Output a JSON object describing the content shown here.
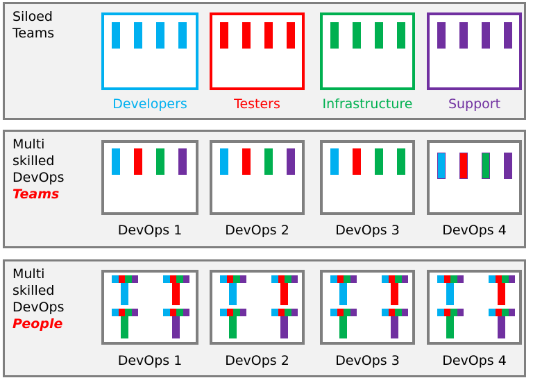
{
  "colors": {
    "developers": "#00b0f0",
    "testers": "#ff0000",
    "infrastructure": "#00b050",
    "support": "#7030a0",
    "frame": "#7f7f7f",
    "emphasis": "#ff0000"
  },
  "rows": [
    {
      "id": "siloed",
      "label_lines": [
        "Siloed",
        "Teams"
      ],
      "label_emphasis": "",
      "teams": [
        {
          "caption": "Developers",
          "frame": "developers",
          "members": [
            "developers",
            "developers",
            "developers",
            "developers"
          ]
        },
        {
          "caption": "Testers",
          "frame": "testers",
          "members": [
            "testers",
            "testers",
            "testers",
            "testers"
          ]
        },
        {
          "caption": "Infrastructure",
          "frame": "infrastructure",
          "members": [
            "infrastructure",
            "infrastructure",
            "infrastructure",
            "infrastructure"
          ]
        },
        {
          "caption": "Support",
          "frame": "support",
          "members": [
            "support",
            "support",
            "support",
            "support"
          ]
        }
      ]
    },
    {
      "id": "devops-teams",
      "label_lines": [
        "Multi",
        "skilled",
        "DevOps"
      ],
      "label_emphasis": "Teams",
      "teams": [
        {
          "caption": "DevOps 1",
          "frame": "frame",
          "members": [
            "developers",
            "testers",
            "infrastructure",
            "support"
          ]
        },
        {
          "caption": "DevOps 2",
          "frame": "frame",
          "members": [
            "developers",
            "testers",
            "infrastructure",
            "support"
          ]
        },
        {
          "caption": "DevOps 3",
          "frame": "frame",
          "members": [
            "developers",
            "testers",
            "infrastructure",
            "infrastructure"
          ]
        },
        {
          "caption": "DevOps 4",
          "frame": "frame",
          "members": [
            "developers",
            "testers",
            "infrastructure",
            "support"
          ],
          "member_outline": "support"
        }
      ]
    },
    {
      "id": "devops-people",
      "label_lines": [
        "Multi",
        "skilled",
        "DevOps"
      ],
      "label_emphasis": "People",
      "people_top_skills": [
        "developers",
        "testers",
        "infrastructure",
        "support"
      ],
      "teams": [
        {
          "caption": "DevOps 1",
          "frame": "frame",
          "members": [
            "developers",
            "testers",
            "infrastructure",
            "support"
          ]
        },
        {
          "caption": "DevOps 2",
          "frame": "frame",
          "members": [
            "developers",
            "testers",
            "infrastructure",
            "support"
          ]
        },
        {
          "caption": "DevOps 3",
          "frame": "frame",
          "members": [
            "developers",
            "testers",
            "infrastructure",
            "support"
          ]
        },
        {
          "caption": "DevOps 4",
          "frame": "frame",
          "members": [
            "developers",
            "testers",
            "infrastructure",
            "support"
          ]
        }
      ]
    }
  ]
}
